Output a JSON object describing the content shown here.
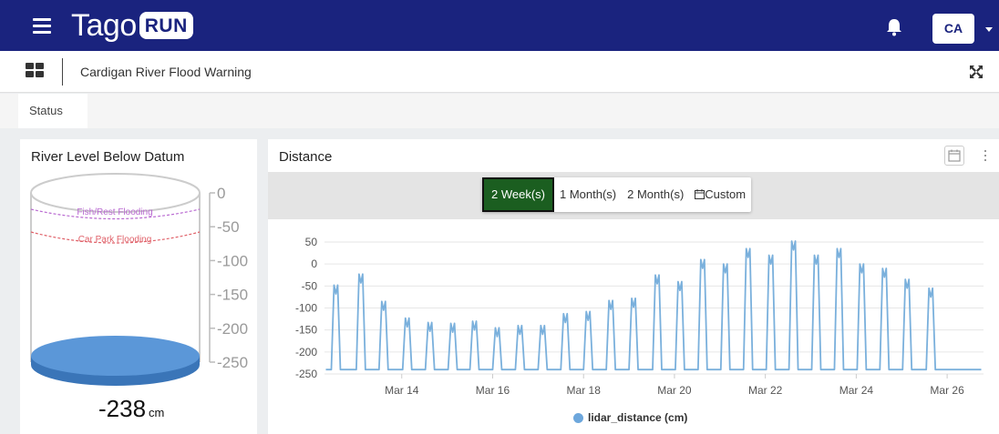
{
  "topbar": {
    "logo_text": "Tago",
    "logo_badge": "RUN",
    "avatar_initials": "CA",
    "icons": [
      "hamburger-menu-icon",
      "bell-icon",
      "chevron-down-icon"
    ]
  },
  "dashboard": {
    "title": "Cardigan River Flood Warning",
    "icons": [
      "dashboards-grid-icon",
      "fullscreen-expand-icon"
    ]
  },
  "tabs": [
    {
      "label": "Status"
    }
  ],
  "river_level_widget": {
    "title": "River Level Below Datum",
    "value": "-238",
    "unit": "cm",
    "scale_labels": [
      "0",
      "-50",
      "-100",
      "-150",
      "-200",
      "-250"
    ],
    "scale_min": -250,
    "scale_max": 0,
    "thresholds": [
      {
        "label": "Fish/Rest Flooding",
        "color": "#b96ad1"
      },
      {
        "label": "Car Park Flooding",
        "color": "#e0626a"
      }
    ],
    "fill_color": "#4a8ad0"
  },
  "distance_widget": {
    "title": "Distance",
    "range_buttons": [
      "2 Week(s)",
      "1 Month(s)",
      "2 Month(s)",
      "Custom"
    ],
    "active_range": "2 Week(s)",
    "accent_color": "#1b5e20",
    "icons": [
      "calendar-icon",
      "kebab-menu-icon"
    ]
  },
  "chart_data": {
    "type": "line",
    "series": [
      {
        "name": "lidar_distance (cm)",
        "color": "#7ab0dc",
        "x": [
          "Mar 12.5",
          "Mar 13.0",
          "Mar 13.5",
          "Mar 14.0",
          "Mar 14.5",
          "Mar 15.0",
          "Mar 15.5",
          "Mar 16.0",
          "Mar 16.5",
          "Mar 17.0",
          "Mar 17.5",
          "Mar 18.0",
          "Mar 18.5",
          "Mar 19.0",
          "Mar 19.5",
          "Mar 20.0",
          "Mar 20.5",
          "Mar 21.0",
          "Mar 21.5",
          "Mar 22.0",
          "Mar 22.5",
          "Mar 23.0",
          "Mar 23.5",
          "Mar 24.0",
          "Mar 24.5",
          "Mar 25.0",
          "Mar 25.5",
          "Mar 26.0",
          "Mar 26.5"
        ],
        "peaks": [
          -68,
          -43,
          -105,
          -143,
          -153,
          -155,
          -150,
          -165,
          -160,
          -160,
          -133,
          -128,
          -103,
          -98,
          -45,
          -60,
          -10,
          -20,
          15,
          0,
          32,
          0,
          15,
          -20,
          -30,
          -55,
          -75
        ],
        "baseline": -240
      }
    ],
    "x_ticks": [
      "Mar 14",
      "Mar 16",
      "Mar 18",
      "Mar 20",
      "Mar 22",
      "Mar 24",
      "Mar 26"
    ],
    "x_tick_positions_days": [
      14,
      16,
      18,
      20,
      22,
      24,
      26
    ],
    "peak_days": [
      12.55,
      13.1,
      13.6,
      14.12,
      14.62,
      15.12,
      15.6,
      16.1,
      16.6,
      17.1,
      17.6,
      18.1,
      18.6,
      19.1,
      19.62,
      20.12,
      20.62,
      21.12,
      21.62,
      22.12,
      22.62,
      23.12,
      23.62,
      24.12,
      24.62,
      25.12,
      25.64
    ],
    "x_range_days": [
      12.3,
      26.8
    ],
    "y_ticks": [
      50,
      0,
      -50,
      -100,
      -150,
      -200,
      -250
    ],
    "ylim": [
      -250,
      50
    ],
    "grid": true,
    "legend": "bottom",
    "legend_label": "lidar_distance (cm)"
  }
}
